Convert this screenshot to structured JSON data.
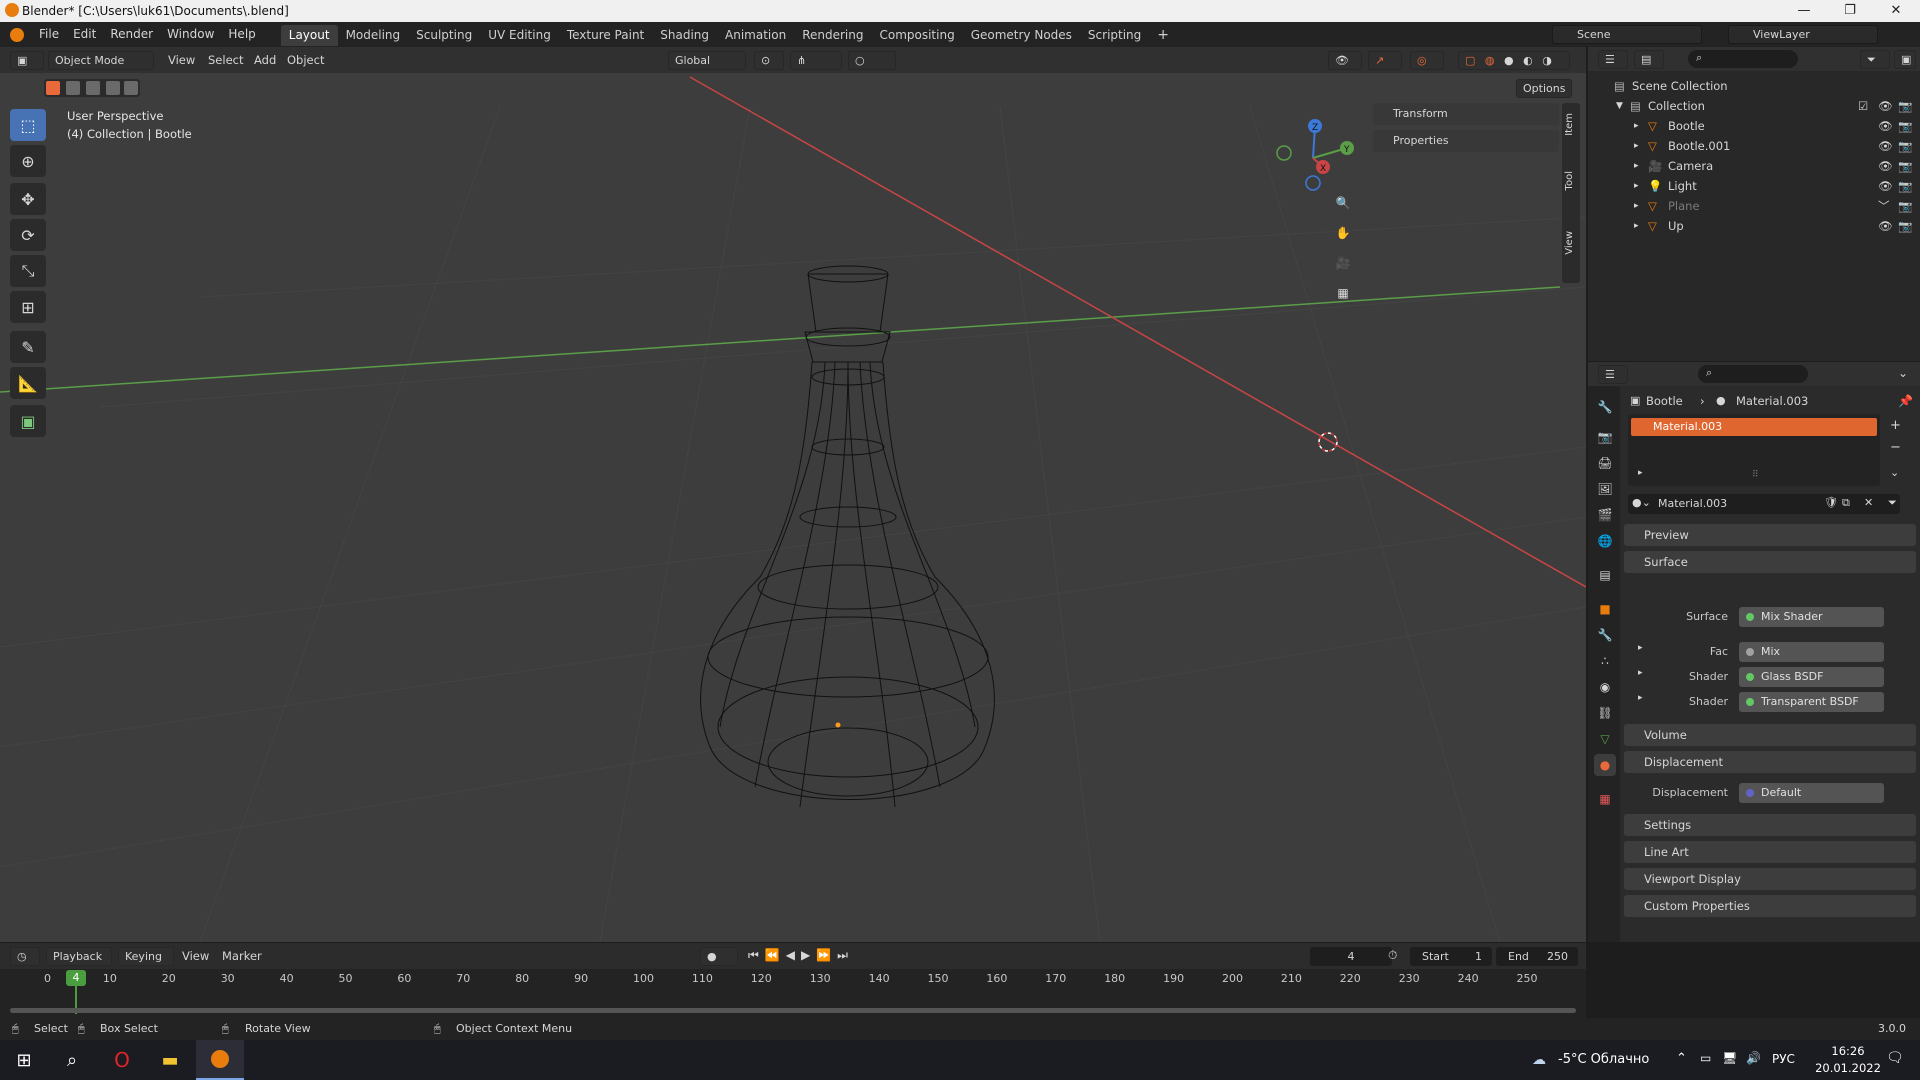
{
  "window": {
    "title": "Blender* [C:\\Users\\luk61\\Documents\\.blend]",
    "min_label": "—",
    "max_label": "❐",
    "close_label": "✕"
  },
  "topbar": {
    "menus": [
      "File",
      "Edit",
      "Render",
      "Window",
      "Help"
    ],
    "workspaces": [
      "Layout",
      "Modeling",
      "Sculpting",
      "UV Editing",
      "Texture Paint",
      "Shading",
      "Animation",
      "Rendering",
      "Compositing",
      "Geometry Nodes",
      "Scripting"
    ],
    "active_workspace": "Layout",
    "add_tab": "+",
    "scene": "Scene",
    "view_layer": "ViewLayer"
  },
  "viewport": {
    "mode": "Object Mode",
    "menus": [
      "View",
      "Select",
      "Add",
      "Object"
    ],
    "orientation": "Global",
    "options": "Options",
    "perspective": "User Perspective",
    "collection_info": "(4) Collection | Bootle",
    "panels": [
      "Transform",
      "Properties"
    ],
    "side_tabs": [
      "Item",
      "Tool",
      "View"
    ],
    "gizmo_labels": {
      "x": "X",
      "y": "Y",
      "z": "Z"
    },
    "tools": [
      "select-box",
      "cursor",
      "move",
      "rotate",
      "scale",
      "transform",
      "annotate",
      "measure",
      "add-cube"
    ],
    "active_tool": "select-box"
  },
  "outliner": {
    "root": "Scene Collection",
    "collection": "Collection",
    "items": [
      {
        "name": "Bootle",
        "icon": "mesh-object",
        "dimmed": false
      },
      {
        "name": "Bootle.001",
        "icon": "mesh-object",
        "dimmed": false
      },
      {
        "name": "Camera",
        "icon": "camera-object",
        "dimmed": false
      },
      {
        "name": "Light",
        "icon": "light-object",
        "dimmed": false
      },
      {
        "name": "Plane",
        "icon": "mesh-object",
        "dimmed": true
      },
      {
        "name": "Up",
        "icon": "mesh-object",
        "dimmed": false
      }
    ]
  },
  "properties": {
    "breadcrumb_object": "Bootle",
    "breadcrumb_separator": "›",
    "breadcrumb_material": "Material.003",
    "slot": "Material.003",
    "material_name": "Material.003",
    "sections": {
      "preview": "Preview",
      "surface": "Surface",
      "volume": "Volume",
      "displacement": "Displacement",
      "settings": "Settings",
      "line_art": "Line Art",
      "viewport_display": "Viewport Display",
      "custom_properties": "Custom Properties"
    },
    "fields": {
      "surface_label": "Surface",
      "surface_value": "Mix Shader",
      "fac_label": "Fac",
      "fac_value": "Mix",
      "shader1_label": "Shader",
      "shader1_value": "Glass BSDF",
      "shader2_label": "Shader",
      "shader2_value": "Transparent BSDF",
      "displacement_label": "Displacement",
      "displacement_value": "Default"
    }
  },
  "timeline": {
    "menus": [
      "Playback",
      "Keying",
      "View",
      "Marker"
    ],
    "current_frame": "4",
    "start_label": "Start",
    "start": "1",
    "end_label": "End",
    "end": "250",
    "ticks": [
      "0",
      "10",
      "20",
      "30",
      "40",
      "50",
      "60",
      "70",
      "80",
      "90",
      "100",
      "110",
      "120",
      "130",
      "140",
      "150",
      "160",
      "170",
      "180",
      "190",
      "200",
      "210",
      "220",
      "230",
      "240",
      "250"
    ]
  },
  "statusbar": {
    "select": "Select",
    "box_select": "Box Select",
    "rotate_view": "Rotate View",
    "context_menu": "Object Context Menu",
    "version": "3.0.0"
  },
  "taskbar": {
    "weather": "-5°C  Облачно",
    "lang": "РУС",
    "time": "16:26",
    "date": "20.01.2022"
  },
  "colors": {
    "accent": "#4772b3",
    "material_slot": "#e0662f",
    "x_axis": "#c94545",
    "y_axis": "#5a9e48"
  }
}
